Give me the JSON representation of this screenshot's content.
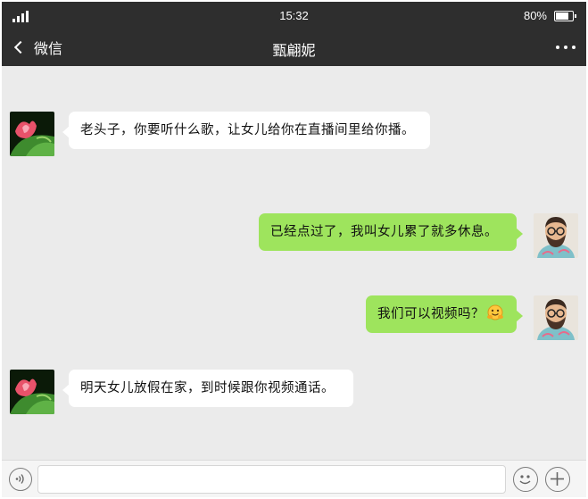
{
  "status_bar": {
    "time": "15:32",
    "battery": "80%",
    "battery_level": 0.8,
    "signal_icon": "signal-bars-icon"
  },
  "nav": {
    "back_label": "微信",
    "title": "甄翩妮",
    "more_icon": "more-dots-icon"
  },
  "messages": [
    {
      "side": "in",
      "text": "老头子，你要听什么歌，让女儿给你在直播间里给你播。"
    },
    {
      "side": "out",
      "text": "已经点过了，我叫女儿累了就多休息。"
    },
    {
      "side": "out",
      "text": "我们可以视频吗？",
      "emoji": "hugging-face-emoji"
    },
    {
      "side": "in",
      "text": "明天女儿放假在家，到时候跟你视频通话。"
    }
  ],
  "input_bar": {
    "value": "",
    "voice_icon": "voice-icon",
    "emoji_icon": "emoji-icon",
    "add_icon": "plus-icon"
  },
  "colors": {
    "header": "#2e2e2e",
    "background": "#ebebeb",
    "out_bubble": "#9ee45d",
    "in_bubble": "#ffffff"
  }
}
